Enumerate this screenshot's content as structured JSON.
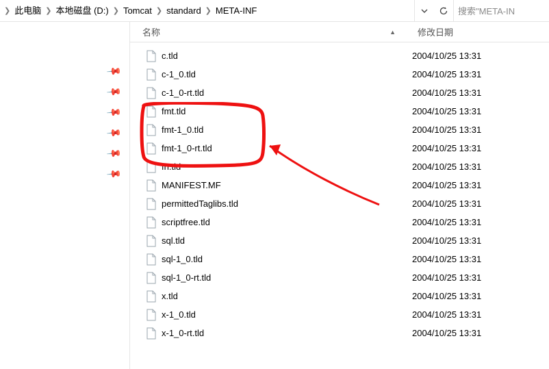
{
  "breadcrumb": {
    "items": [
      "此电脑",
      "本地磁盘 (D:)",
      "Tomcat",
      "standard",
      "META-INF"
    ]
  },
  "search": {
    "placeholder": "搜索\"META-IN"
  },
  "columns": {
    "name": "名称",
    "date": "修改日期"
  },
  "files": [
    {
      "name": "c.tld",
      "date": "2004/10/25 13:31"
    },
    {
      "name": "c-1_0.tld",
      "date": "2004/10/25 13:31"
    },
    {
      "name": "c-1_0-rt.tld",
      "date": "2004/10/25 13:31"
    },
    {
      "name": "fmt.tld",
      "date": "2004/10/25 13:31"
    },
    {
      "name": "fmt-1_0.tld",
      "date": "2004/10/25 13:31"
    },
    {
      "name": "fmt-1_0-rt.tld",
      "date": "2004/10/25 13:31"
    },
    {
      "name": "fn.tld",
      "date": "2004/10/25 13:31"
    },
    {
      "name": "MANIFEST.MF",
      "date": "2004/10/25 13:31"
    },
    {
      "name": "permittedTaglibs.tld",
      "date": "2004/10/25 13:31"
    },
    {
      "name": "scriptfree.tld",
      "date": "2004/10/25 13:31"
    },
    {
      "name": "sql.tld",
      "date": "2004/10/25 13:31"
    },
    {
      "name": "sql-1_0.tld",
      "date": "2004/10/25 13:31"
    },
    {
      "name": "sql-1_0-rt.tld",
      "date": "2004/10/25 13:31"
    },
    {
      "name": "x.tld",
      "date": "2004/10/25 13:31"
    },
    {
      "name": "x-1_0.tld",
      "date": "2004/10/25 13:31"
    },
    {
      "name": "x-1_0-rt.tld",
      "date": "2004/10/25 13:31"
    }
  ],
  "pins": [
    0,
    1,
    2,
    3,
    4,
    5
  ]
}
